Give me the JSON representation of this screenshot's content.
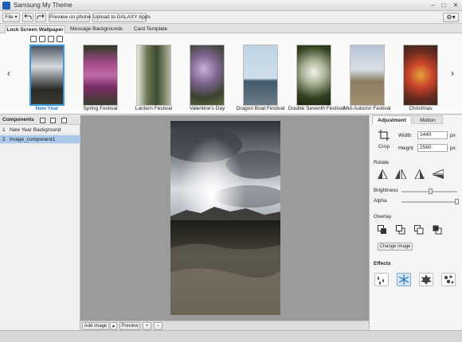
{
  "window": {
    "title": "Samsung My Theme",
    "app_icon": "samsung-theme-app-icon",
    "minimize": "–",
    "maximize": "□",
    "close": "✕"
  },
  "toolbar": {
    "file_label": "File ▾",
    "preview_phone_label": "Preview on phone",
    "upload_label": "Upload to GALAXY Apps",
    "undo_icon": "undo-icon",
    "redo_icon": "redo-icon",
    "settings_icon": "gear-icon"
  },
  "tabs": [
    {
      "label": "Lock Screen Wallpaper",
      "active": true
    },
    {
      "label": "Message Backgrounds",
      "active": false
    },
    {
      "label": "Card Template",
      "active": false
    }
  ],
  "gallery": {
    "prev": "‹",
    "next": "›",
    "items": [
      {
        "label": "New Year",
        "selected": true
      },
      {
        "label": "Spring Festival",
        "selected": false
      },
      {
        "label": "Lantern Festival",
        "selected": false
      },
      {
        "label": "Valentine's Day",
        "selected": false
      },
      {
        "label": "Dragon Boat Festival",
        "selected": false
      },
      {
        "label": "Double Seventh Festival",
        "selected": false
      },
      {
        "label": "Mid-Autumn Festival",
        "selected": false
      },
      {
        "label": "Christmas",
        "selected": false
      }
    ]
  },
  "components": {
    "title": "Components",
    "rows": [
      {
        "num": "1",
        "name": "New Year Background",
        "selected": false
      },
      {
        "num": "2",
        "name": "Image_component1",
        "selected": true
      }
    ]
  },
  "canvas_bottom": {
    "add_image": "Add image",
    "add_image_arrow": "▴",
    "preview": "Preview",
    "zoom_in": "+",
    "zoom_out": "−"
  },
  "properties": {
    "tabs": [
      "Adjustment",
      "Motion"
    ],
    "crop_label": "Crop",
    "width_label": "Width",
    "width_value": "1440",
    "height_label": "Height",
    "height_value": "2560",
    "unit": "px",
    "rotate_label": "Rotate",
    "brightness_label": "Brightness",
    "brightness_level": 0.55,
    "alpha_label": "Alpha",
    "alpha_level": 1.0,
    "overlay_label": "Overlay",
    "change_image_label": "Change image",
    "effects_label": "Effects"
  },
  "colors": {
    "accent": "#2a86cf",
    "selection": "#a9c9ea",
    "canvas": "#9b9b9b"
  }
}
